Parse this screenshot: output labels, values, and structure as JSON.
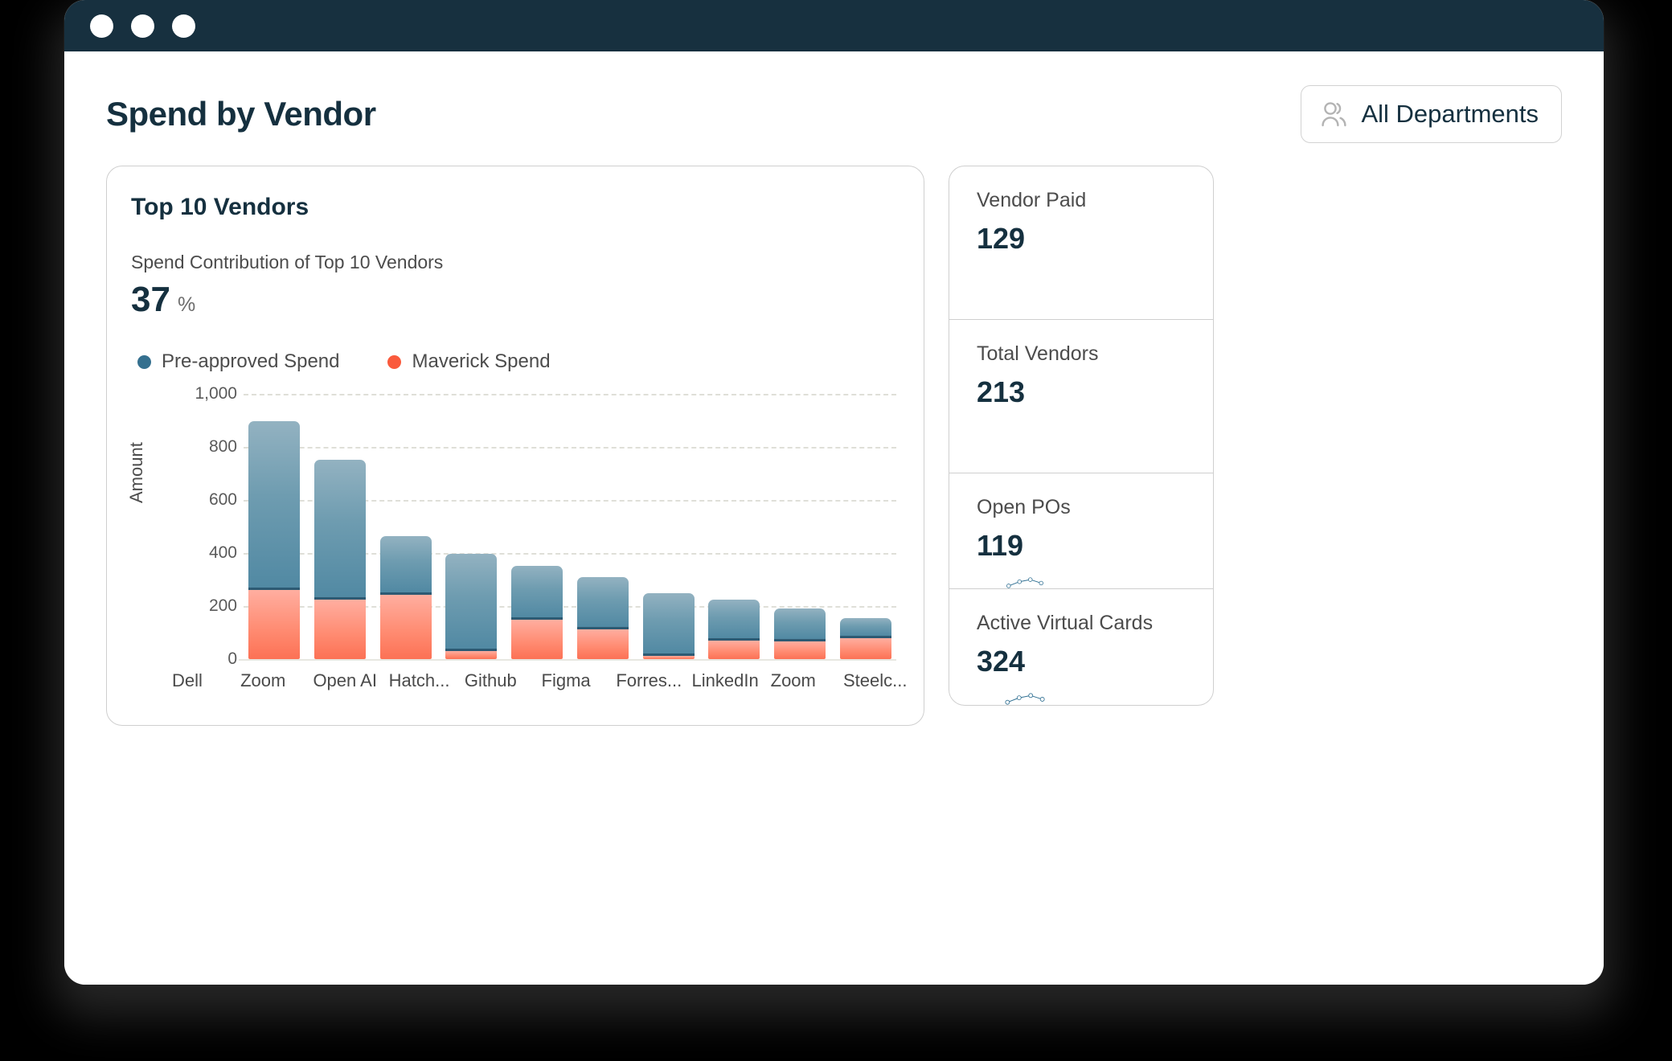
{
  "window": {
    "traffic_lights": [
      "close-dot",
      "minimize-dot",
      "maximize-dot"
    ]
  },
  "header": {
    "title": "Spend by Vendor",
    "department_filter": {
      "label": "All Departments",
      "icon": "people-icon"
    }
  },
  "chart_card": {
    "title": "Top 10 Vendors",
    "subtitle": "Spend Contribution of Top 10 Vendors",
    "stat_value": "37",
    "stat_unit": "%"
  },
  "legend": [
    {
      "label": "Pre-approved Spend",
      "color": "#35708f"
    },
    {
      "label": "Maverick Spend",
      "color": "#fa5a3c"
    }
  ],
  "kpis": [
    {
      "label": "Vendor Paid",
      "value": "129",
      "has_sparkline": false
    },
    {
      "label": "Total Vendors",
      "value": "213",
      "has_sparkline": false
    },
    {
      "label": "Open POs",
      "value": "119",
      "has_sparkline": true
    },
    {
      "label": "Active Virtual Cards",
      "value": "324",
      "has_sparkline": true
    }
  ],
  "sparkline": {
    "color": "#2f6f92",
    "points": [
      10,
      40,
      55,
      30
    ]
  },
  "chart_data": {
    "type": "bar",
    "stacked": true,
    "title": "Top 10 Vendors",
    "subtitle": "Spend Contribution of Top 10 Vendors",
    "xlabel": "",
    "ylabel": "Amount",
    "ylim": [
      0,
      1000
    ],
    "yticks": [
      0,
      200,
      400,
      600,
      800,
      1000
    ],
    "ytick_labels": [
      "0",
      "200",
      "400",
      "600",
      "800",
      "1,000"
    ],
    "grid": true,
    "legend_position": "above-plot-left",
    "categories": [
      "Dell",
      "Zoom",
      "Open AI",
      "Hatch...",
      "Github",
      "Figma",
      "Forres...",
      "LinkedIn",
      "Zoom",
      "Steelc..."
    ],
    "series": [
      {
        "name": "Maverick Spend",
        "color": "#fc7155",
        "values": [
          260,
          225,
          243,
          30,
          150,
          112,
          12,
          70,
          68,
          80
        ]
      },
      {
        "name": "Pre-approved Spend",
        "color": "#5189a3",
        "values": [
          637,
          527,
          222,
          368,
          203,
          198,
          238,
          155,
          124,
          75
        ]
      }
    ],
    "totals": [
      897,
      752,
      465,
      398,
      353,
      310,
      250,
      225,
      192,
      155
    ]
  }
}
